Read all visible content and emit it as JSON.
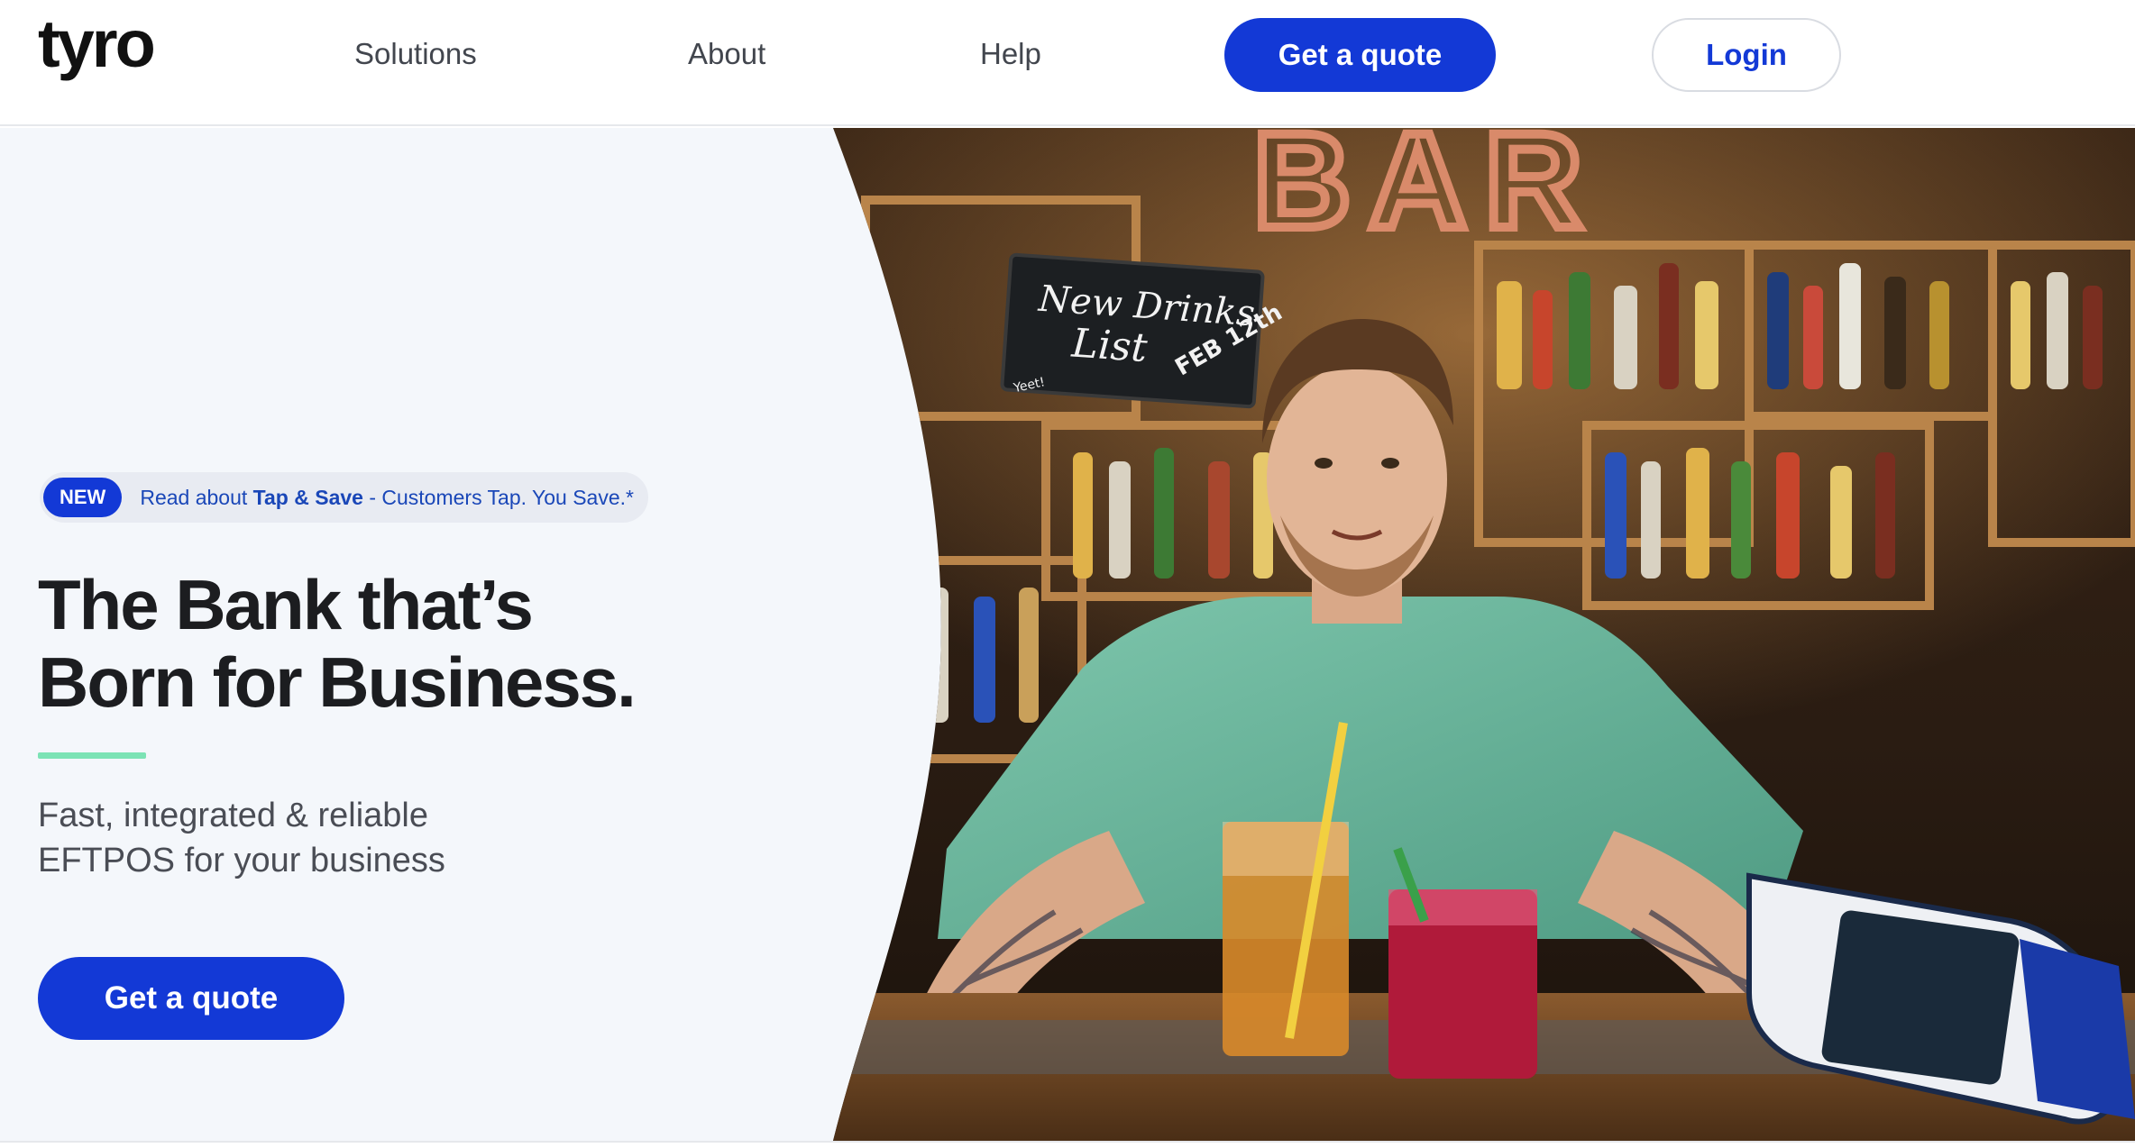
{
  "header": {
    "logo": "tyro",
    "nav": [
      "Solutions",
      "About",
      "Help"
    ],
    "quote_label": "Get a quote",
    "login_label": "Login"
  },
  "hero": {
    "announcement": {
      "badge": "NEW",
      "prefix": "Read about ",
      "link": "Tap & Save",
      "suffix": " - Customers Tap. You Save.*"
    },
    "headline": [
      "The Bank that’s",
      "Born for Business."
    ],
    "subtitle": [
      "Fast, integrated & reliable",
      "EFTPOS for your business"
    ],
    "cta_label": "Get a quote",
    "chalkboard": {
      "line1": "New Drinks",
      "line2": "List",
      "date": "FEB 12th",
      "small": "Yeet!"
    },
    "sign_letters": "BAR"
  },
  "colors": {
    "brand_blue": "#1339d6",
    "accent_green": "#7ce3b5",
    "hero_bg": "#f4f7fb",
    "text_dark": "#1c1d20"
  }
}
